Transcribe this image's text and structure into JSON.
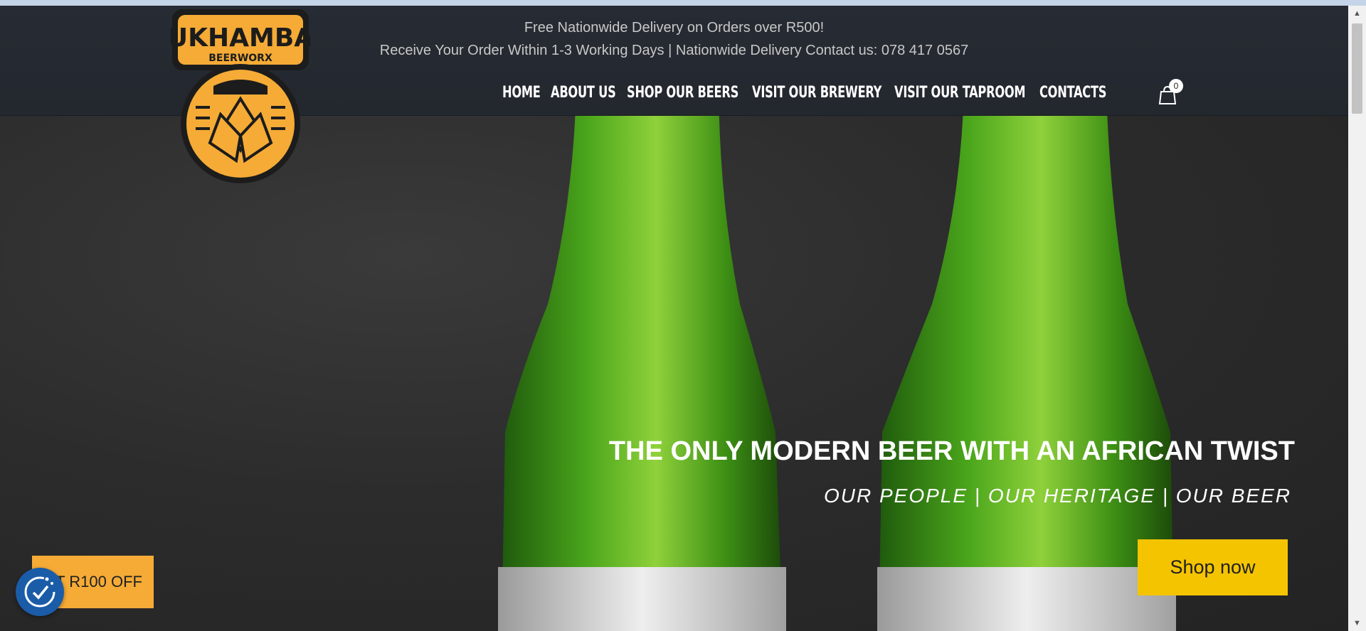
{
  "promo": {
    "line1": "Free Nationwide Delivery on Orders over R500!",
    "line2": "Receive Your Order Within 1-3 Working Days | Nationwide Delivery  Contact us: 078 417 0567"
  },
  "logo": {
    "name": "UKHAMBA",
    "sub": "BEERWORX",
    "colors": {
      "orange": "#f5ab36",
      "dark": "#1c1c1c"
    }
  },
  "nav": {
    "items": [
      {
        "label": "HOME"
      },
      {
        "label": "ABOUT US"
      },
      {
        "label": "SHOP OUR BEERS"
      },
      {
        "label": "VISIT OUR BREWERY"
      },
      {
        "label": "VISIT OUR TAPROOM"
      },
      {
        "label": "CONTACTS"
      }
    ],
    "cart_count": "0",
    "cart_icon": "shopping-bag-icon"
  },
  "hero": {
    "title": "THE ONLY MODERN BEER WITH AN AFRICAN TWIST",
    "subtitle": "OUR PEOPLE | OUR HERITAGE | OUR BEER",
    "cta_label": "Shop now",
    "cta_color": "#f4c400"
  },
  "discount": {
    "label": "GET R100 OFF",
    "color": "#f5ab36"
  },
  "cookie": {
    "icon": "cookie-consent-icon",
    "color": "#1a5ca8"
  },
  "scrollbar": {
    "up_icon": "scroll-up-arrow-icon",
    "down_icon": "scroll-down-arrow-icon"
  }
}
